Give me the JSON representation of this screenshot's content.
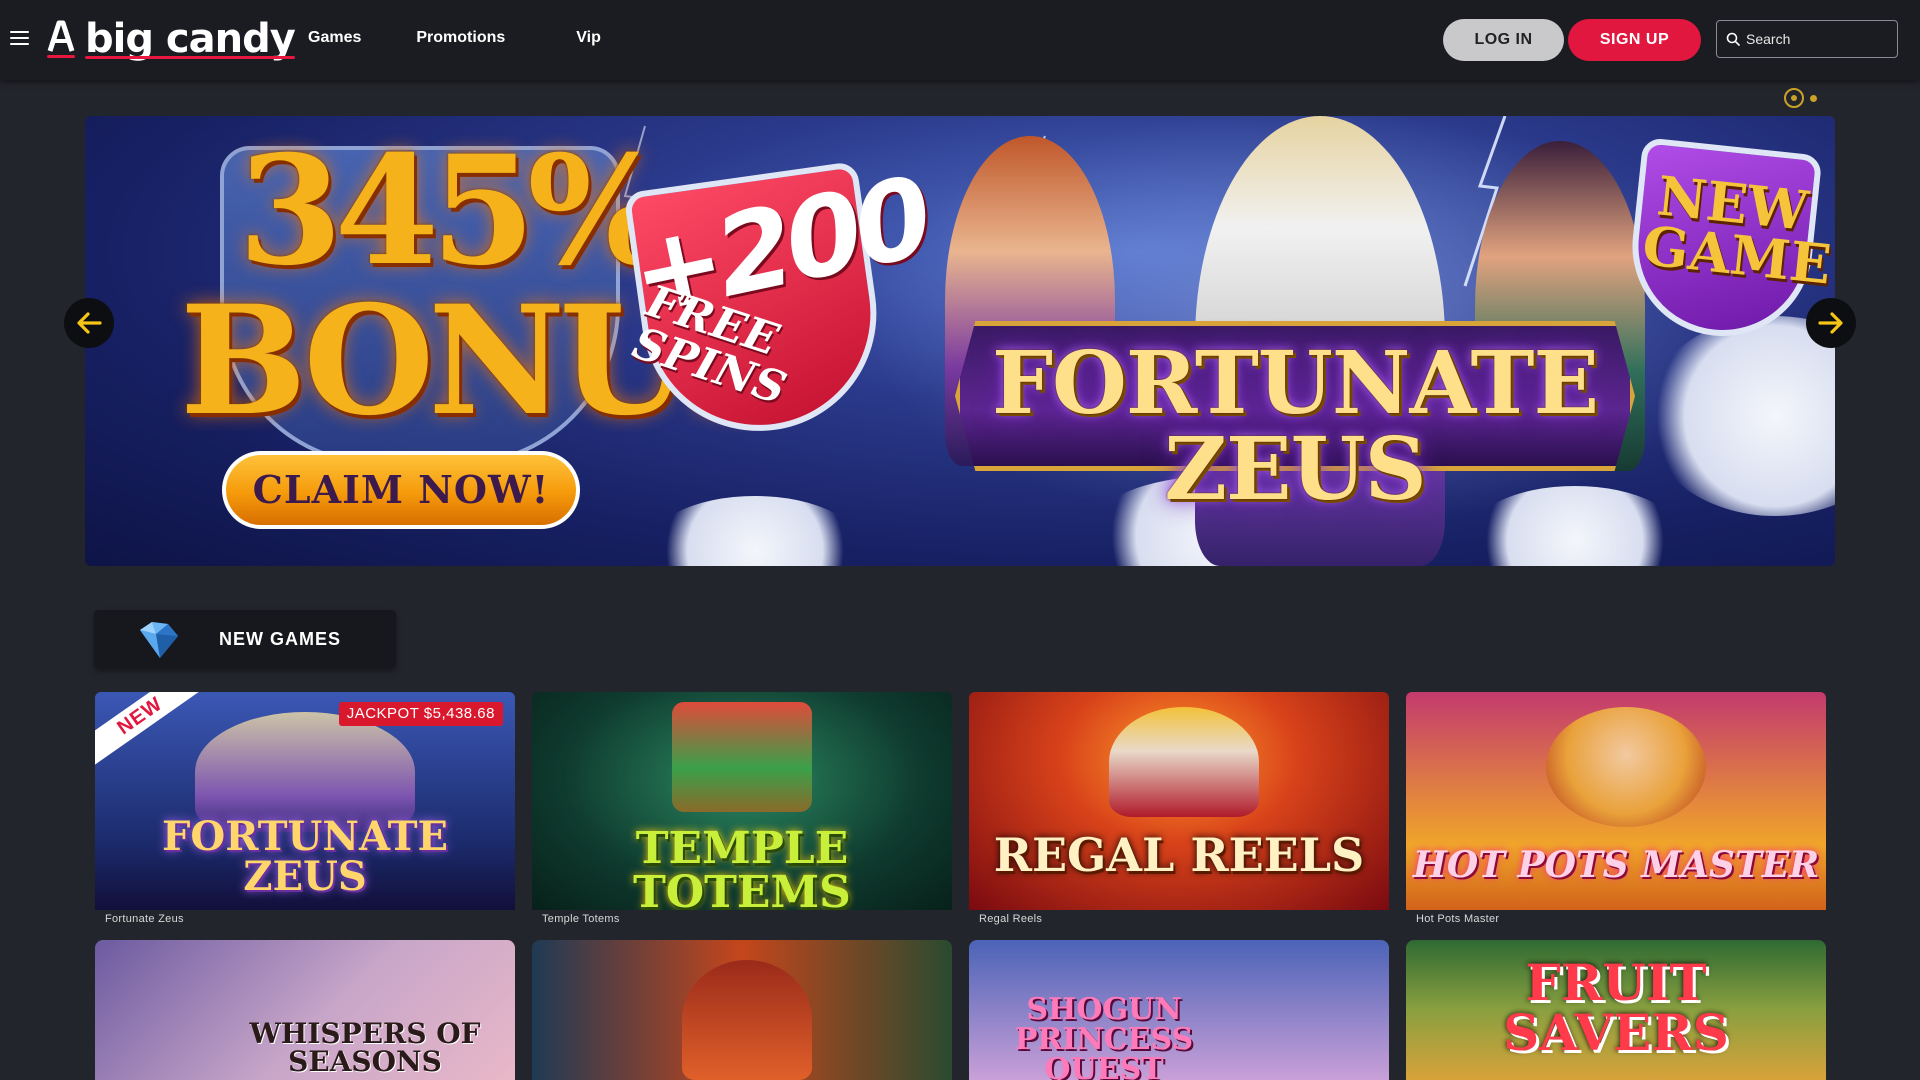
{
  "header": {
    "logo_text": "big candy",
    "nav": {
      "games": "Games",
      "promotions": "Promotions",
      "vip": "Vip"
    },
    "login_label": "LOG IN",
    "signup_label": "SIGN UP",
    "search_placeholder": "Search"
  },
  "carousel": {
    "slide_count": 2,
    "active_slide": 1,
    "banner": {
      "bonus_percent": "345%",
      "bonus_word": "BONUS",
      "claim_label": "CLAIM NOW!",
      "spins_number": "+200",
      "spins_label": "FREE SPINS",
      "game_title": "FORTUNATE ZEUS",
      "badge_line1": "NEW",
      "badge_line2": "GAME"
    }
  },
  "section": {
    "title": "NEW GAMES",
    "icon": "diamond-icon"
  },
  "games": [
    {
      "name": "Fortunate Zeus",
      "title_art": "FORTUNATE ZEUS",
      "new_badge": "NEW",
      "jackpot": "JACKPOT $5,438.68",
      "colors": [
        "#1b2a6b",
        "#3a4ea8"
      ]
    },
    {
      "name": "Temple Totems",
      "title_art": "TEMPLE TOTEMS",
      "colors": [
        "#0f3b2f",
        "#1e6a4a"
      ]
    },
    {
      "name": "Regal Reels",
      "title_art": "REGAL REELS",
      "colors": [
        "#8b0f14",
        "#e0601a"
      ]
    },
    {
      "name": "Hot Pots Master",
      "title_art": "HOT POTS MASTER",
      "colors": [
        "#c33a6e",
        "#f0a52a"
      ]
    }
  ],
  "games_row2": [
    {
      "title_art": "WHISPERS OF SEASONS",
      "colors": [
        "#6c5aa0",
        "#e9b8c8"
      ]
    },
    {
      "title_art": "",
      "colors": [
        "#1f3a55",
        "#c4461b"
      ]
    },
    {
      "title_art": "SHOGUN PRINCESS QUEST",
      "colors": [
        "#4b63b7",
        "#c9a0d8"
      ]
    },
    {
      "title_art": "FRUIT SAVERS",
      "colors": [
        "#2f6a32",
        "#d8a23a"
      ]
    }
  ]
}
